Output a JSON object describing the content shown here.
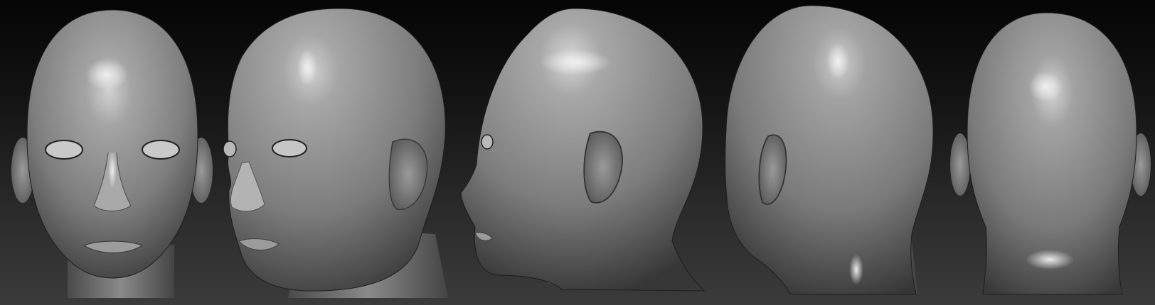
{
  "scene": {
    "background_top": "#050505",
    "background_bottom": "#3b3b3b",
    "material_base": "#7d7d7d",
    "material_light": "#cfcfcf",
    "material_shadow": "#2a2a2a",
    "views": [
      {
        "view": "front"
      },
      {
        "view": "three-quarter-left"
      },
      {
        "view": "profile-left"
      },
      {
        "view": "three-quarter-back-left"
      },
      {
        "view": "back"
      }
    ]
  }
}
